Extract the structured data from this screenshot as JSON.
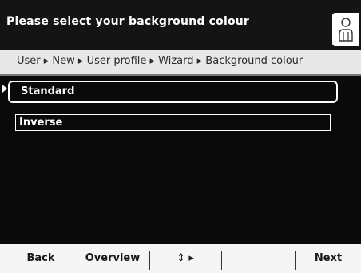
{
  "header": {
    "title": "Please select your background colour"
  },
  "breadcrumb": {
    "path": "User ▸ New ▸ User profile ▸ Wizard ▸ Background colour"
  },
  "options": [
    {
      "label": "Standard",
      "selected": true
    },
    {
      "label": "Inverse",
      "selected": false
    }
  ],
  "softkeys": {
    "back": "Back",
    "overview": "Overview",
    "navigate": "⇕ ▸",
    "blank": "",
    "next": "Next"
  },
  "icons": {
    "user": "user-icon",
    "selection_marker": "selection-arrow-icon"
  }
}
